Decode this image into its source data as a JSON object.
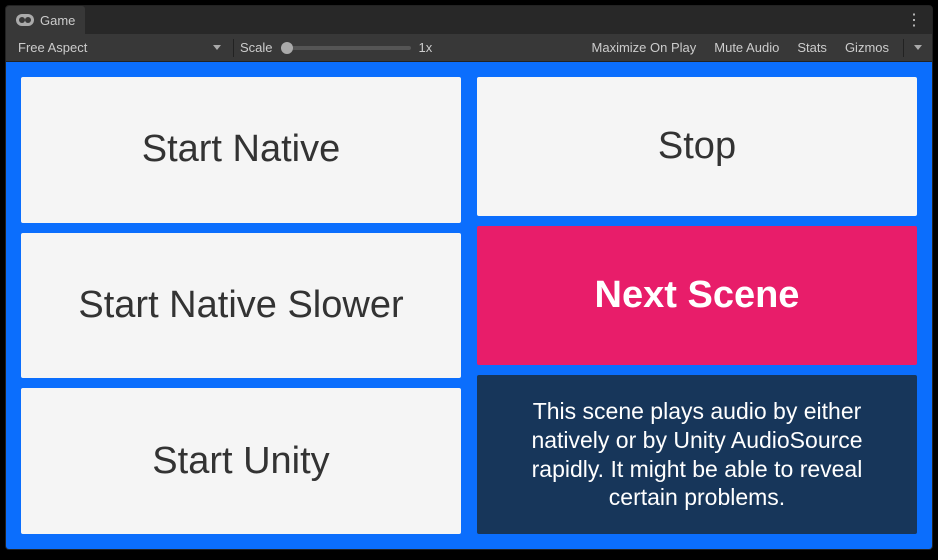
{
  "tab": {
    "label": "Game"
  },
  "toolbar": {
    "aspect": "Free Aspect",
    "scale_label": "Scale",
    "scale_value": "1x",
    "maximize": "Maximize On Play",
    "mute": "Mute Audio",
    "stats": "Stats",
    "gizmos": "Gizmos"
  },
  "game": {
    "left_buttons": {
      "start_native": "Start Native",
      "start_native_slower": "Start Native Slower",
      "start_unity": "Start Unity"
    },
    "right_buttons": {
      "stop": "Stop",
      "next_scene": "Next Scene"
    },
    "info_text": "This scene plays audio by either natively or by Unity AudioSource rapidly. It might be able to reveal certain problems."
  }
}
